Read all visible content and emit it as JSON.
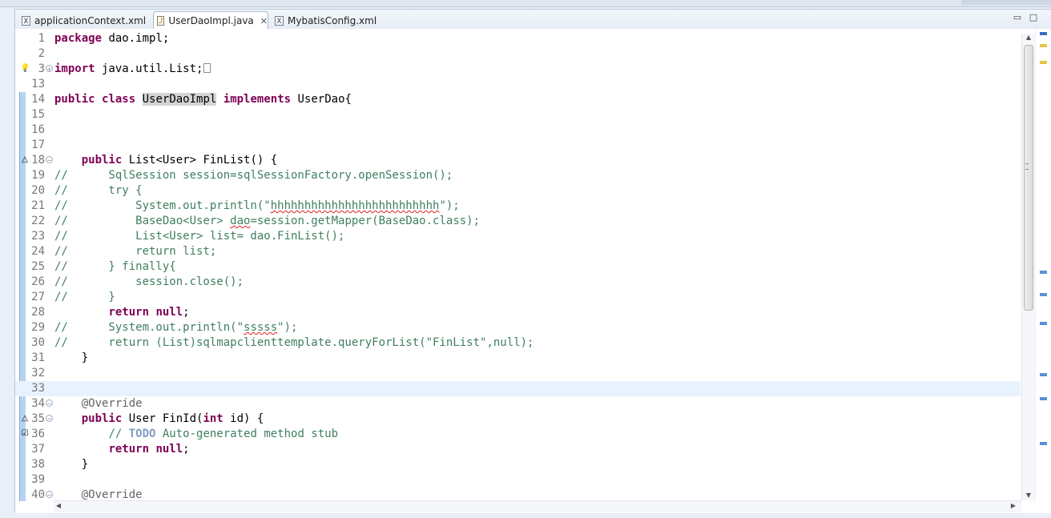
{
  "tabs": [
    {
      "label": "applicationContext.xml",
      "icon": "xml-file-icon",
      "active": false
    },
    {
      "label": "UserDaoImpl.java",
      "icon": "java-file-icon",
      "active": true
    },
    {
      "label": "MybatisConfig.xml",
      "icon": "xml-file-icon",
      "active": false
    }
  ],
  "tab_icon_glyphs": {
    "xml": "X",
    "java": "J"
  },
  "close_glyph": "✕",
  "window_controls": {
    "minimize": "▭",
    "maximize": "□"
  },
  "lines": [
    {
      "num": "1",
      "html": "<span class=\"kw\">package</span> dao.impl;"
    },
    {
      "num": "2",
      "html": ""
    },
    {
      "num": "3",
      "html": "<span class=\"kw\">import</span> java.util.List;"
    },
    {
      "num": "13",
      "html": ""
    },
    {
      "num": "14",
      "html": "<span class=\"kw\">public</span> <span class=\"kw\">class</span> <span class=\"hl\">UserDaoImpl</span> <span class=\"kw\">implements</span> UserDao{"
    },
    {
      "num": "15",
      "html": ""
    },
    {
      "num": "16",
      "html": ""
    },
    {
      "num": "17",
      "html": ""
    },
    {
      "num": "18",
      "html": "    <span class=\"kw\">public</span> List&lt;User&gt; FinList() {"
    },
    {
      "num": "19",
      "html": "<span class=\"cm\">//      SqlSession session=sqlSessionFactory.openSession();</span>"
    },
    {
      "num": "20",
      "html": "<span class=\"cm\">//      try {</span>"
    },
    {
      "num": "21",
      "html": "<span class=\"cm\">//          System.out.println(\"<span class=\"squig\">hhhhhhhhhhhhhhhhhhhhhhhhh</span>\");</span>"
    },
    {
      "num": "22",
      "html": "<span class=\"cm\">//          BaseDao&lt;User&gt; <span class=\"squig\">dao</span>=session.getMapper(BaseDao.class);</span>"
    },
    {
      "num": "23",
      "html": "<span class=\"cm\">//          List&lt;User&gt; list= dao.FinList();</span>"
    },
    {
      "num": "24",
      "html": "<span class=\"cm\">//          return list;</span>"
    },
    {
      "num": "25",
      "html": "<span class=\"cm\">//      } finally{</span>"
    },
    {
      "num": "26",
      "html": "<span class=\"cm\">//          session.close();</span>"
    },
    {
      "num": "27",
      "html": "<span class=\"cm\">//      }</span>"
    },
    {
      "num": "28",
      "html": "        <span class=\"kw\">return</span> <span class=\"kw\">null</span>;"
    },
    {
      "num": "29",
      "html": "<span class=\"cm\">//      System.out.println(\"<span class=\"squig\">sssss</span>\");</span>"
    },
    {
      "num": "30",
      "html": "<span class=\"cm\">//      return (List)sqlmapclienttemplate.queryForList(\"FinList\",null);</span>"
    },
    {
      "num": "31",
      "html": "    }"
    },
    {
      "num": "32",
      "html": ""
    },
    {
      "num": "33",
      "html": ""
    },
    {
      "num": "34",
      "html": "    <span class=\"ann\">@Override</span>"
    },
    {
      "num": "35",
      "html": "    <span class=\"kw\">public</span> User FinId(<span class=\"kw\">int</span> id) {"
    },
    {
      "num": "36",
      "html": "        <span class=\"cm\">// <span class=\"todo\">TODO</span> Auto-generated method stub</span>"
    },
    {
      "num": "37",
      "html": "        <span class=\"kw\">return</span> <span class=\"kw\">null</span>;"
    },
    {
      "num": "38",
      "html": "    }"
    },
    {
      "num": "39",
      "html": ""
    },
    {
      "num": "40",
      "html": "    <span class=\"ann\">@Override</span>"
    }
  ],
  "editor": {
    "current_line": "33",
    "fold_expanded": [
      "3"
    ],
    "fold_collapsible": [
      "18",
      "34",
      "35",
      "40"
    ],
    "markers": [
      {
        "line": "3",
        "kind": "warning-lightbulb-icon",
        "glyph": "💡"
      },
      {
        "line": "18",
        "kind": "override-triangle-icon",
        "glyph": "△"
      },
      {
        "line": "35",
        "kind": "override-triangle-icon",
        "glyph": "△"
      },
      {
        "line": "36",
        "kind": "task-checkbox-icon",
        "glyph": "☑"
      }
    ]
  },
  "colors": {
    "keyword": "#7f0055",
    "comment": "#3f7f5f",
    "string": "#2a00ff",
    "annotation": "#646464",
    "current_line_bg": "#e8f2fe",
    "occurrence_highlight": "#d4d4d4"
  }
}
